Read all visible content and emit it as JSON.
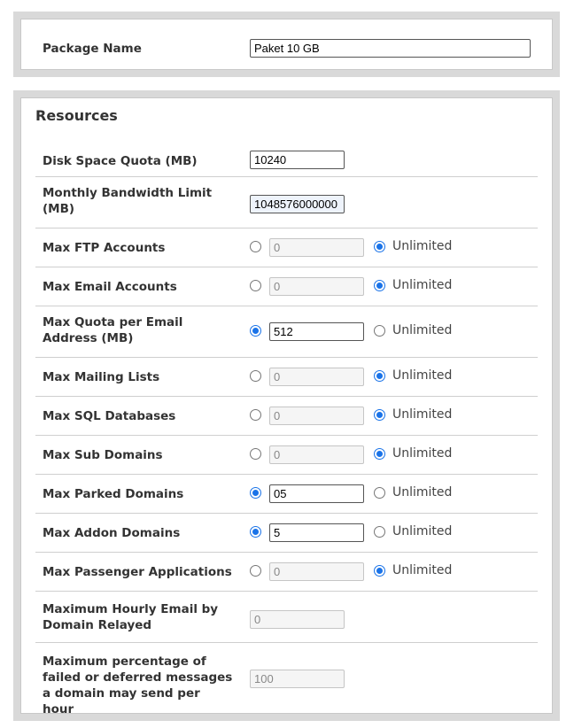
{
  "package": {
    "label": "Package Name",
    "value": "Paket 10 GB"
  },
  "resources": {
    "title": "Resources",
    "unlimited_label": "Unlimited",
    "disk_quota": {
      "label": "Disk Space Quota (MB)",
      "value": "10240"
    },
    "bandwidth": {
      "label": "Monthly Bandwidth Limit (MB)",
      "value": "1048576000000"
    },
    "rows": [
      {
        "label": "Max FTP Accounts",
        "value": "0",
        "unlimited": true
      },
      {
        "label": "Max Email Accounts",
        "value": "0",
        "unlimited": true
      },
      {
        "label": "Max Quota per Email Address (MB)",
        "value": "512",
        "unlimited": false
      },
      {
        "label": "Max Mailing Lists",
        "value": "0",
        "unlimited": true
      },
      {
        "label": "Max SQL Databases",
        "value": "0",
        "unlimited": true
      },
      {
        "label": "Max Sub Domains",
        "value": "0",
        "unlimited": true
      },
      {
        "label": "Max Parked Domains",
        "value": "05",
        "unlimited": false
      },
      {
        "label": "Max Addon Domains",
        "value": "5",
        "unlimited": false
      },
      {
        "label": "Max Passenger Applications",
        "value": "0",
        "unlimited": true
      }
    ],
    "hourly_email": {
      "label": "Maximum Hourly Email by Domain Relayed",
      "value": "0"
    },
    "failed_pct": {
      "label": "Maximum percentage of failed or deferred messages a domain may send per hour",
      "value": "100"
    }
  }
}
